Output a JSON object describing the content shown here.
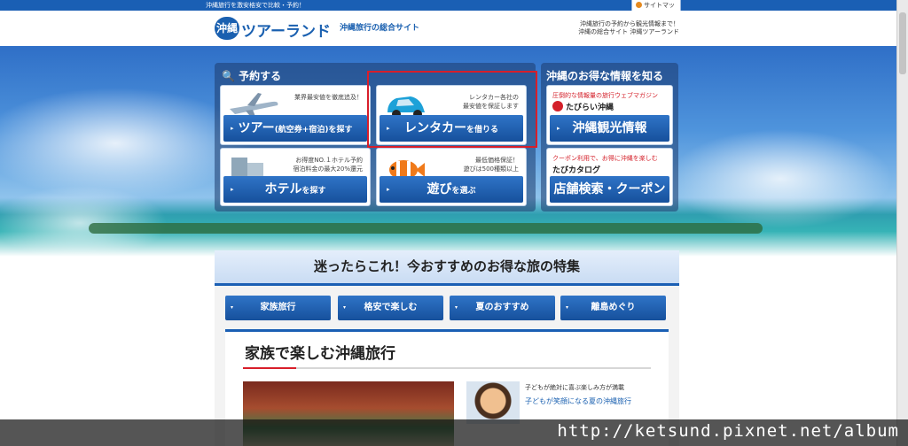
{
  "topbar": {
    "tagline": "沖縄旅行を激安格安で比較・予約！",
    "sitemap": "サイトマップ"
  },
  "header": {
    "logo_badge": "沖縄",
    "logo_text": "ツアーランド",
    "logo_sub": "沖縄旅行の総合サイト",
    "note_line1": "沖縄旅行の予約から観光情報まで！",
    "note_line2": "沖縄の総合サイト 沖縄ツアーランド"
  },
  "booking": {
    "title": "予約する",
    "cards": [
      {
        "desc1": "業界最安値を徹底追及！",
        "desc2": "",
        "label": "ツアー",
        "label_small": "(航空券+宿泊)",
        "label_tail": "を探す"
      },
      {
        "desc1": "レンタカー各社の",
        "desc2": "最安値を保証します",
        "label": "レンタカー",
        "label_small": "",
        "label_tail": "を借りる"
      },
      {
        "desc1": "お得度NO.１ホテル予約",
        "desc2": "宿泊料金の最大20%還元",
        "label": "ホテル",
        "label_small": "",
        "label_tail": "を探す"
      },
      {
        "desc1": "最低価格保証！",
        "desc2": "遊びは500種類以上",
        "label": "遊び",
        "label_small": "",
        "label_tail": "を選ぶ"
      }
    ]
  },
  "info": {
    "title": "沖縄のお得な情報を知る",
    "cards": [
      {
        "head": "圧倒的な情報量の旅行ウェブマガジン",
        "brand": "たびらい沖縄",
        "label": "沖縄観光情報"
      },
      {
        "head": "クーポン利用で、お得に沖縄を楽しむ",
        "brand": "たびカタログ",
        "label": "店舗検索・クーポン"
      }
    ]
  },
  "feature": {
    "heading": "迷ったらこれ！今おすすめのお得な旅の特集",
    "tabs": [
      "家族旅行",
      "格安で楽しむ",
      "夏のおすすめ",
      "離島めぐり"
    ],
    "section_title": "家族で楽しむ沖縄旅行",
    "side_text1": "子どもが絶対に喜ぶ楽しみ方が満載",
    "side_link": "子どもが笑顔になる夏の沖縄旅行"
  },
  "watermark": "http://ketsund.pixnet.net/album",
  "colors": {
    "brand_blue": "#1a5fb4",
    "highlight_red": "#d81e2a"
  }
}
